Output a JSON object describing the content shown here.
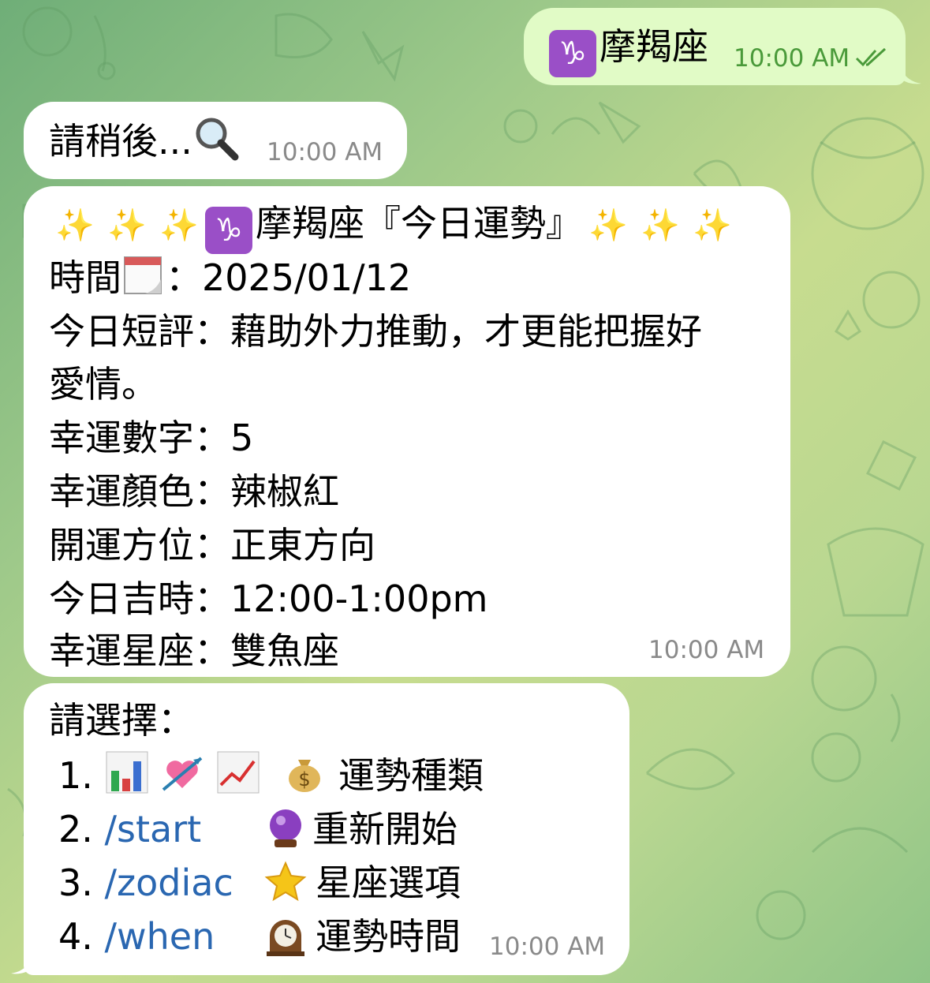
{
  "messages": {
    "sent": {
      "text": "摩羯座",
      "time": "10:00 AM",
      "status": "read",
      "icon": "capricorn-icon"
    },
    "wait": {
      "text": "請稍後...",
      "icon": "magnifier-icon",
      "time": "10:00 AM"
    },
    "fortune": {
      "title": "摩羯座『今日運勢』",
      "title_icons": [
        "sparkles-icon",
        "capricorn-icon"
      ],
      "date_label": "時間",
      "date_icon": "calendar-icon",
      "date_value": "：2025/01/12",
      "review_line1": "今日短評：藉助外力推動，才更能把握好",
      "review_line2": "愛情。",
      "lucky_number": "幸運數字：5",
      "lucky_color": "幸運顏色：辣椒紅",
      "lucky_direction": "開運方位：正東方向",
      "lucky_time": "今日吉時：12:00-1:00pm",
      "lucky_sign": "幸運星座：雙魚座",
      "time": "10:00 AM"
    },
    "menu": {
      "prompt": "請選擇：",
      "items": [
        {
          "num": "1.",
          "cmd": "",
          "label": "運勢種類",
          "icons": [
            "bar-chart-icon",
            "heart-arrow-icon",
            "trend-up-icon",
            "money-bag-icon"
          ]
        },
        {
          "num": "2.",
          "cmd": "/start",
          "label": "重新開始",
          "icons": [
            "crystal-ball-icon"
          ]
        },
        {
          "num": "3.",
          "cmd": "/zodiac",
          "label": "星座選項",
          "icons": [
            "star-icon"
          ]
        },
        {
          "num": "4.",
          "cmd": "/when",
          "label": "運勢時間",
          "icons": [
            "clock-icon"
          ]
        }
      ],
      "time": "10:00 AM"
    }
  },
  "colors": {
    "incoming_bubble": "#ffffff",
    "outgoing_bubble": "#e1fbc6",
    "link": "#2a67b1",
    "read_check": "#4a9a3a",
    "capricorn_badge": "#9a4fc7"
  }
}
